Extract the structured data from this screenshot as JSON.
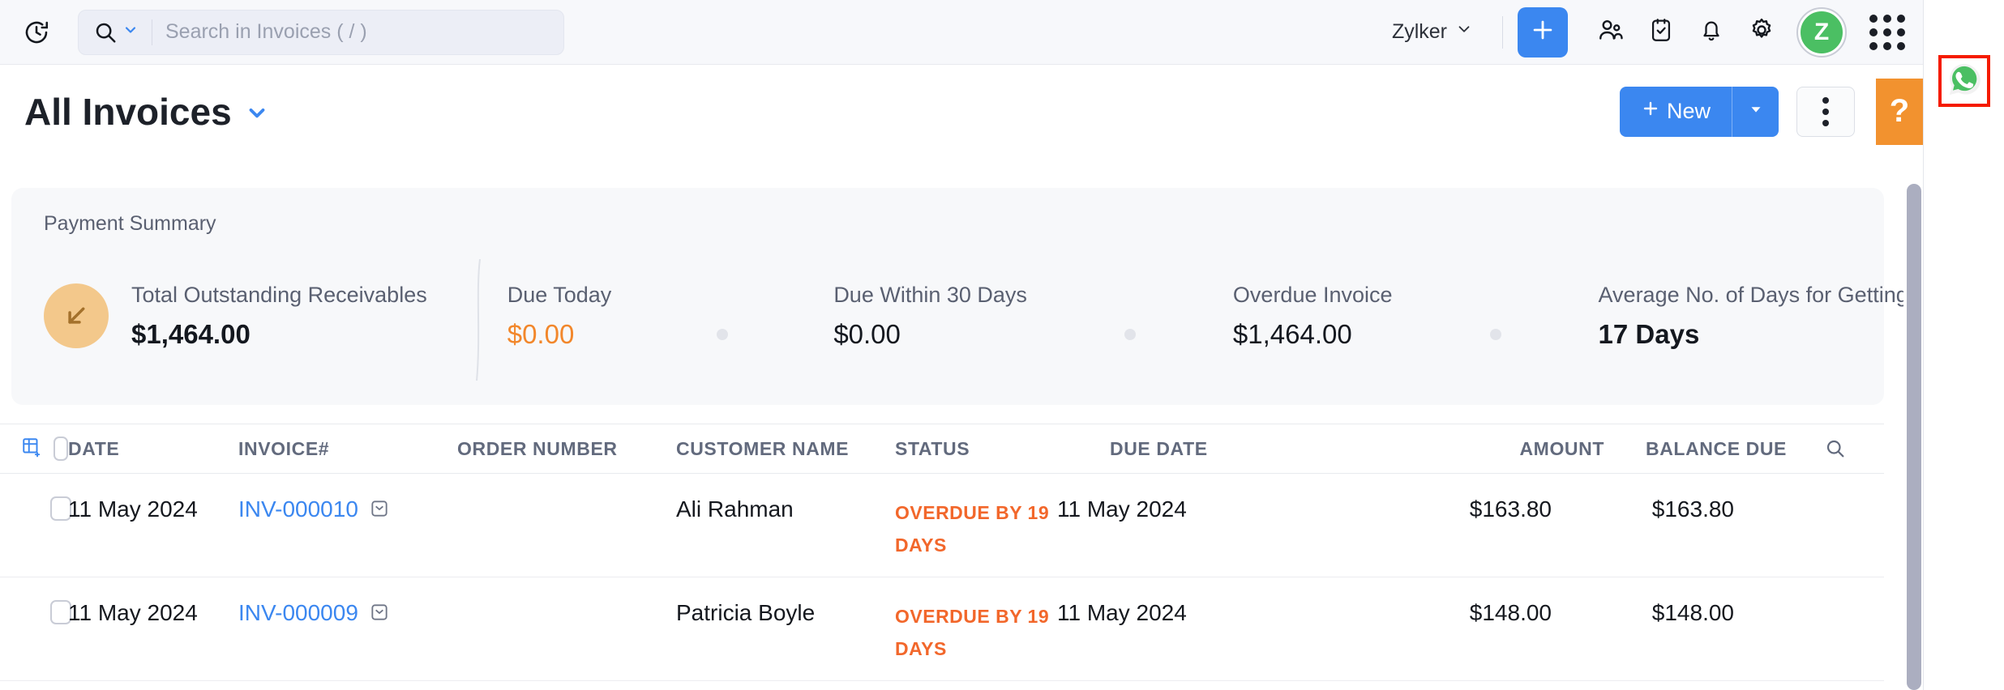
{
  "topbar": {
    "recent_icon": "clock-recent-icon",
    "search": {
      "placeholder": "Search in Invoices ( / )",
      "value": "",
      "icon": "search-icon",
      "caret_icon": "chevron-down-icon"
    },
    "org_name": "Zylker",
    "org_caret_icon": "chevron-down-icon",
    "actions": [
      {
        "name": "add-button",
        "icon": "plus-icon"
      },
      {
        "name": "contacts-button",
        "icon": "people-icon"
      },
      {
        "name": "tasks-button",
        "icon": "clipboard-check-icon"
      },
      {
        "name": "notifications-button",
        "icon": "bell-icon"
      },
      {
        "name": "settings-button",
        "icon": "gear-icon"
      }
    ],
    "avatar_letter": "Z",
    "apps_icon": "grid-apps-icon"
  },
  "page": {
    "title": "All Invoices",
    "title_caret_icon": "chevron-down-icon",
    "new_button": "New",
    "new_button_icon": "plus-icon",
    "new_split_icon": "chevron-down-icon",
    "more_button_icon": "kebab-menu-icon",
    "help_button": "?"
  },
  "right_rail": {
    "whatsapp_icon": "whatsapp-icon",
    "highlight_color": "#f51b00"
  },
  "summary": {
    "heading": "Payment Summary",
    "badge_icon": "arrow-down-left-icon",
    "badge_color": "#f3c88b",
    "items": [
      {
        "label": "Total Outstanding Receivables",
        "value": "$1,464.00",
        "style": "bold"
      },
      {
        "label": "Due Today",
        "value": "$0.00",
        "style": "orange"
      },
      {
        "label": "Due Within 30 Days",
        "value": "$0.00",
        "style": "plain"
      },
      {
        "label": "Overdue Invoice",
        "value": "$1,464.00",
        "style": "plain"
      },
      {
        "label": "Average No. of Days for Getting Paid",
        "value": "17 Days",
        "style": "bold"
      }
    ]
  },
  "table": {
    "header_icons": {
      "add_column_icon": "add-column-icon",
      "select_all_checkbox": "checkbox-icon",
      "search_icon": "search-icon"
    },
    "columns": [
      "DATE",
      "INVOICE#",
      "ORDER NUMBER",
      "CUSTOMER NAME",
      "STATUS",
      "DUE DATE",
      "AMOUNT",
      "BALANCE DUE"
    ],
    "rows": [
      {
        "date": "11 May 2024",
        "invoice": "INV-000010",
        "invoice_icon": "mail-icon",
        "order_number": "",
        "customer": "Ali Rahman",
        "status": "OVERDUE BY 19 DAYS",
        "due_date": "11 May 2024",
        "amount": "$163.80",
        "balance_due": "$163.80"
      },
      {
        "date": "11 May 2024",
        "invoice": "INV-000009",
        "invoice_icon": "mail-icon",
        "order_number": "",
        "customer": "Patricia Boyle",
        "status": "OVERDUE BY 19 DAYS",
        "due_date": "11 May 2024",
        "amount": "$148.00",
        "balance_due": "$148.00"
      }
    ]
  },
  "colors": {
    "accent_blue": "#3b87f0",
    "status_orange": "#f2672b",
    "help_orange": "#f2922f",
    "whatsapp_green": "#4bbf63"
  }
}
